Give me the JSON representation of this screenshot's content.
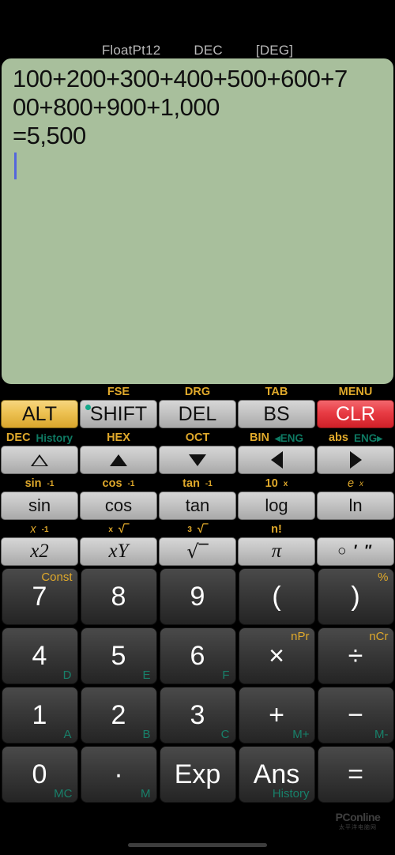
{
  "status": {
    "precision": "FloatPt12",
    "base": "DEC",
    "angle_mode": "[DEG]"
  },
  "display": {
    "line1": "100+200+300+400+500+600+7",
    "line2": "00+800+900+1,000",
    "line3": "=5,500",
    "expression": "100+200+300+400+500+600+700+800+900+1,000",
    "result": "=5,500",
    "background_color": "#a8bf9c",
    "cursor_color": "#5566dd"
  },
  "colors": {
    "gold": "#e0a92b",
    "teal": "#18806a",
    "red": "#e83c44",
    "key_grey": "#c3c3c3",
    "key_dark": "#3a3a3a"
  },
  "keypad": {
    "row_mode": {
      "labels": [
        {
          "main": ""
        },
        {
          "main": "FSE"
        },
        {
          "main": "DRG"
        },
        {
          "main": "TAB"
        },
        {
          "main": "MENU"
        }
      ],
      "keys": [
        {
          "label": "ALT",
          "style": "gold"
        },
        {
          "label": "SHIFT",
          "style": "grey",
          "indicator": true
        },
        {
          "label": "DEL",
          "style": "grey"
        },
        {
          "label": "BS",
          "style": "grey"
        },
        {
          "label": "CLR",
          "style": "red"
        }
      ]
    },
    "row_arrows": {
      "labels": [
        {
          "main": "DEC",
          "alt": "History"
        },
        {
          "main": "HEX"
        },
        {
          "main": "OCT"
        },
        {
          "main": "BIN",
          "alt": "◂ENG"
        },
        {
          "main": "abs",
          "alt": "ENG▸"
        }
      ],
      "keys": [
        {
          "icon": "triangle-up-outline-icon",
          "name": "page-up"
        },
        {
          "icon": "triangle-up-icon",
          "name": "cursor-up"
        },
        {
          "icon": "triangle-down-icon",
          "name": "cursor-down"
        },
        {
          "icon": "triangle-left-icon",
          "name": "cursor-left"
        },
        {
          "icon": "triangle-right-icon",
          "name": "cursor-right"
        }
      ]
    },
    "row_trig": {
      "labels": [
        {
          "base": "sin",
          "sup": "-1"
        },
        {
          "base": "cos",
          "sup": "-1"
        },
        {
          "base": "tan",
          "sup": "-1"
        },
        {
          "base": "10",
          "sup": "x"
        },
        {
          "base": "e",
          "sup": "x"
        }
      ],
      "keys": [
        "sin",
        "cos",
        "tan",
        "log",
        "ln"
      ]
    },
    "row_math": {
      "labels": [
        {
          "base": "x",
          "sup": "-1"
        },
        {
          "base": "√‾",
          "sup": "x",
          "sup_first": true
        },
        {
          "base": "√‾",
          "sup": "3",
          "sup_first": true
        },
        {
          "base": "n!"
        },
        {
          "base": ""
        }
      ],
      "keys": [
        {
          "base": "x",
          "sup": "2"
        },
        {
          "base": "x",
          "sup": "Y"
        },
        {
          "base": "√‾"
        },
        {
          "base": "π"
        },
        {
          "base": "○ ′ ″"
        }
      ]
    },
    "number_rows": [
      [
        {
          "label": "7",
          "tr": "Const"
        },
        {
          "label": "8"
        },
        {
          "label": "9"
        },
        {
          "label": "("
        },
        {
          "label": ")",
          "tr": "%"
        }
      ],
      [
        {
          "label": "4",
          "br": "D"
        },
        {
          "label": "5",
          "br": "E"
        },
        {
          "label": "6",
          "br": "F"
        },
        {
          "label": "×",
          "tr": "nPr"
        },
        {
          "label": "÷",
          "tr": "nCr"
        }
      ],
      [
        {
          "label": "1",
          "br": "A"
        },
        {
          "label": "2",
          "br": "B"
        },
        {
          "label": "3",
          "br": "C"
        },
        {
          "label": "+",
          "br": "M+"
        },
        {
          "label": "−",
          "br": "M-"
        }
      ],
      [
        {
          "label": "0",
          "br": "MC"
        },
        {
          "label": "·",
          "br": "M"
        },
        {
          "label": "Exp"
        },
        {
          "label": "Ans",
          "br": "History"
        },
        {
          "label": "="
        }
      ]
    ]
  },
  "watermark": {
    "main": "PConline",
    "sub": "太平洋电脑网"
  }
}
